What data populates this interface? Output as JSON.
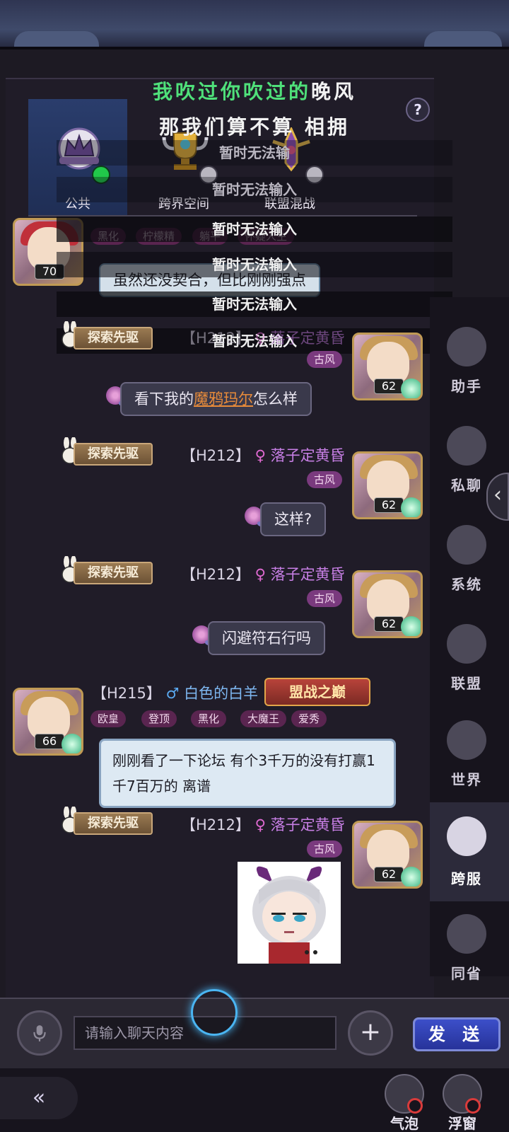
{
  "lyrics": {
    "line1_green": "我吹过你吹过的",
    "line1_white": "晚风",
    "line2": "那我们算不算 相拥"
  },
  "help_icon": "?",
  "tabs": [
    {
      "label": "公共",
      "icon": "crown-emblem-icon",
      "active": true,
      "status": "online"
    },
    {
      "label": "跨界空间",
      "icon": "trophy-emblem-icon",
      "active": false,
      "status": "offline"
    },
    {
      "label": "联盟混战",
      "icon": "sword-emblem-icon",
      "active": false,
      "status": "offline"
    }
  ],
  "overlay": {
    "rows": [
      "暂时无法输",
      "暂时无法输入",
      "暂时无法输入",
      "暂时无法输入",
      "暂时无法输入",
      "暂时无法输入"
    ]
  },
  "top_message": {
    "avatar_level": "70",
    "tags": [
      "黑化",
      "柠檬精",
      "躺平",
      "怀疑人生"
    ],
    "text": "虽然还没契合，但比刚刚强点"
  },
  "messages": [
    {
      "rank": "探索先驱",
      "server": "【H212】",
      "gender_symbol": "♀",
      "name": "落子定黄昏",
      "tag": "古风",
      "level": "62",
      "text_prefix": "看下我的",
      "text_link": "魔鸦玛尔",
      "text_suffix": "怎么样"
    },
    {
      "rank": "探索先驱",
      "server": "【H212】",
      "gender_symbol": "♀",
      "name": "落子定黄昏",
      "tag": "古风",
      "level": "62",
      "text": "这样?"
    },
    {
      "rank": "探索先驱",
      "server": "【H212】",
      "gender_symbol": "♀",
      "name": "落子定黄昏",
      "tag": "古风",
      "level": "62",
      "text": "闪避符石行吗"
    },
    {
      "server": "【H215】",
      "gender_symbol": "♂",
      "name": "白色的白羊",
      "title_badge": "盟战之巅",
      "tags": [
        "欧皇",
        "登顶",
        "黑化",
        "大魔王",
        "爱秀"
      ],
      "level": "66",
      "text": "刚刚看了一下论坛  有个3千万的没有打赢1千7百万的  离谱"
    },
    {
      "rank": "探索先驱",
      "server": "【H212】",
      "gender_symbol": "♀",
      "name": "落子定黄昏",
      "tag": "古风",
      "level": "62",
      "sticker": "chibi-girl-sticker"
    }
  ],
  "sidebar": {
    "items": [
      {
        "label": "助手",
        "icon": "assistant-icon"
      },
      {
        "label": "私聊",
        "icon": "private-chat-icon"
      },
      {
        "label": "系统",
        "icon": "megaphone-icon"
      },
      {
        "label": "联盟",
        "icon": "banner-icon"
      },
      {
        "label": "世界",
        "icon": "compass-icon"
      },
      {
        "label": "跨服",
        "icon": "planet-icon",
        "active": true
      },
      {
        "label": "同省",
        "icon": "location-pin-icon"
      }
    ],
    "collapse_arrow": "‹"
  },
  "input": {
    "placeholder": "请输入聊天内容",
    "send_label": "发 送",
    "plus": "+"
  },
  "bottom": {
    "back_icon": "«",
    "items": [
      {
        "label": "气泡",
        "icon": "bubble-icon"
      },
      {
        "label": "浮窗",
        "icon": "float-window-icon"
      }
    ]
  },
  "colors": {
    "lyric_green": "#4fe07a",
    "link_orange": "#e88b3a",
    "female_pink": "#e06ad2",
    "male_blue": "#5aa9f0",
    "send_blue": "#3c4fc9"
  }
}
